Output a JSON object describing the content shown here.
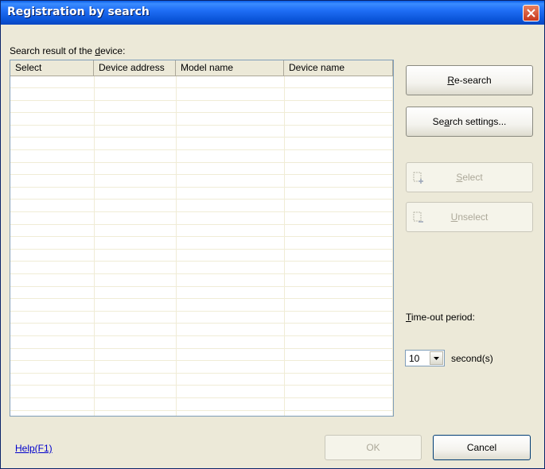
{
  "window": {
    "title": "Registration by search"
  },
  "list": {
    "label_pre": "Search result of the ",
    "label_u": "d",
    "label_post": "evice:",
    "columns": [
      "Select",
      "Device address",
      "Model name",
      "Device name"
    ]
  },
  "buttons": {
    "research_u": "R",
    "research_rest": "e-search",
    "search_settings_pre": "Se",
    "search_settings_u": "a",
    "search_settings_post": "rch settings...",
    "select_u": "S",
    "select_rest": "elect",
    "unselect_u": "U",
    "unselect_rest": "nselect",
    "ok": "OK",
    "cancel": "Cancel"
  },
  "timeout": {
    "label_u": "T",
    "label_rest": "ime-out period:",
    "value": "10",
    "unit": "second(s)"
  },
  "help": {
    "label": "Help(F1)"
  },
  "icons": [
    "close-icon",
    "select-add-icon",
    "unselect-remove-icon",
    "dropdown-arrow-icon"
  ]
}
